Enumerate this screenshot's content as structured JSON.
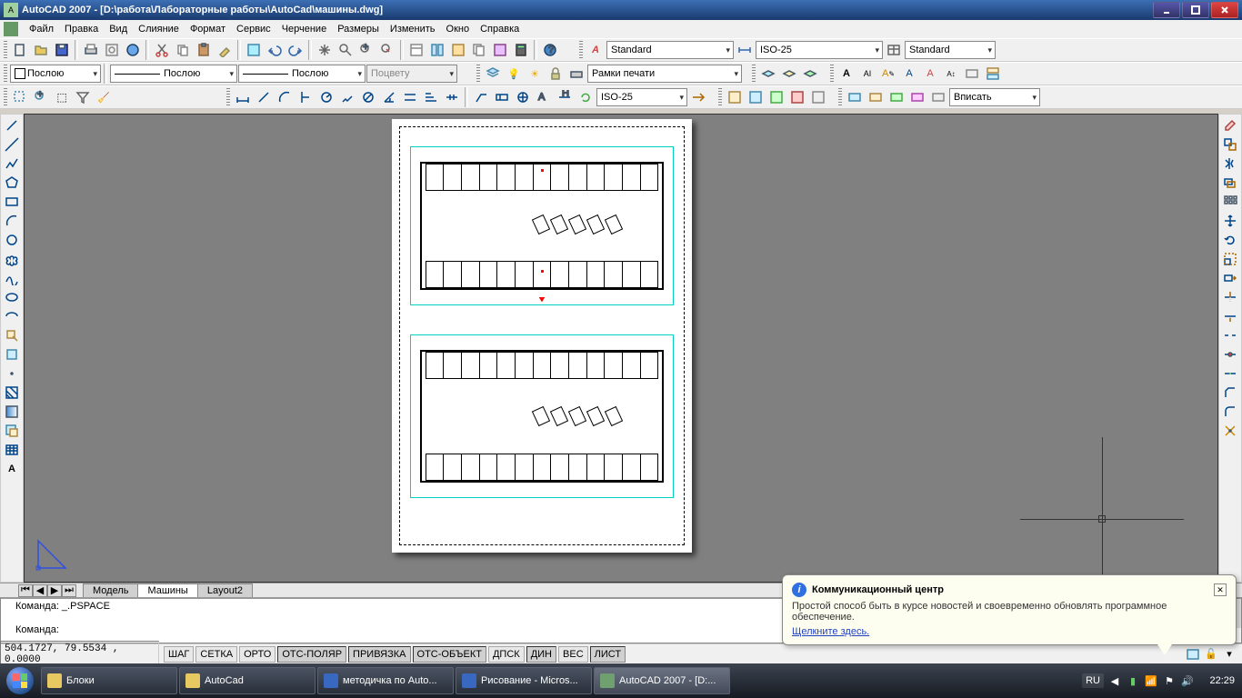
{
  "title": "AutoCAD 2007 - [D:\\работа\\Лабораторные работы\\AutoCad\\машины.dwg]",
  "menu": [
    "Файл",
    "Правка",
    "Вид",
    "Слияние",
    "Формат",
    "Сервис",
    "Черчение",
    "Размеры",
    "Изменить",
    "Окно",
    "Справка"
  ],
  "toolbar2": {
    "layer_combo": "Послою",
    "linetype_combo": "Послою",
    "lineweight_combo": "Послою",
    "plotstyle_combo": "Поцвету",
    "frames_label": "Рамки печати"
  },
  "styles": {
    "text_style": "Standard",
    "dim_style": "ISO-25",
    "table_style": "Standard",
    "dim_style2": "ISO-25",
    "zoom_select": "Вписать"
  },
  "tabs": {
    "model": "Модель",
    "layout1": "Машины",
    "layout2": "Layout2"
  },
  "command": {
    "history1": "Команда: _.PSPACE",
    "prompt": "Команда:"
  },
  "status": {
    "coords": "504.1727,  79.5534 , 0.0000",
    "toggles": [
      "ШАГ",
      "СЕТКА",
      "ОРТО",
      "ОТС-ПОЛЯР",
      "ПРИВЯЗКА",
      "ОТС-ОБЪЕКТ",
      "ДПСК",
      "ДИН",
      "ВЕС",
      "ЛИСТ"
    ],
    "toggle_states": [
      false,
      false,
      false,
      true,
      true,
      true,
      false,
      true,
      false,
      true
    ]
  },
  "notification": {
    "title": "Коммуникационный центр",
    "body": "Простой способ быть в курсе новостей и своевременно обновлять программное обеспечение.",
    "link": "Щелкните здесь."
  },
  "taskbar": {
    "items": [
      {
        "label": "Блоки",
        "color": "#e8c860"
      },
      {
        "label": "AutoCad",
        "color": "#e8c860"
      },
      {
        "label": "методичка по Auto...",
        "color": "#3868c0"
      },
      {
        "label": "Рисование - Micros...",
        "color": "#3868c0"
      },
      {
        "label": "AutoCAD 2007 - [D:...",
        "color": "#70a070",
        "active": true
      }
    ],
    "lang": "RU",
    "clock": "22:29"
  }
}
